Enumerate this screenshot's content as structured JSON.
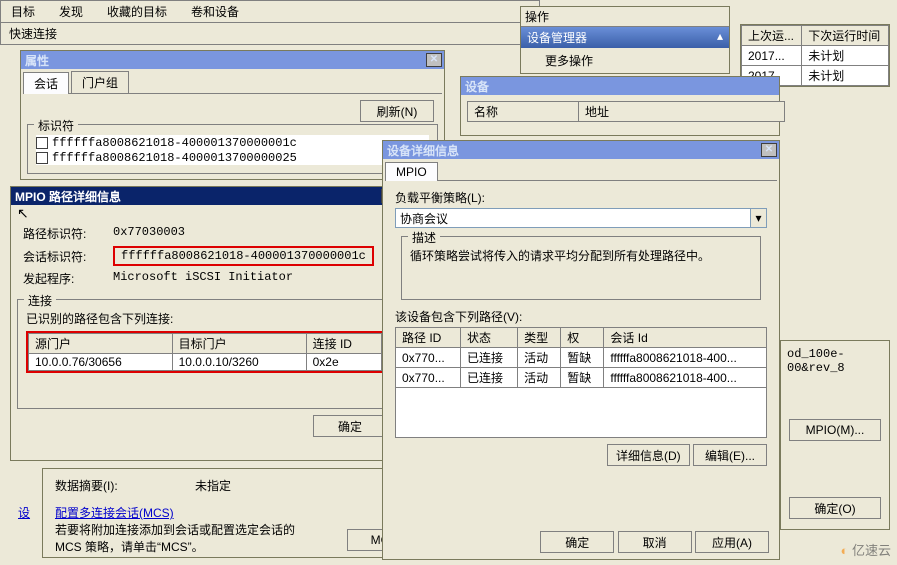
{
  "top_menu": [
    "目标",
    "发现",
    "收藏的目标",
    "卷和设备"
  ],
  "quick_connect": "快速连接",
  "last_run_cols": [
    "上次运...",
    "下次运行时间"
  ],
  "last_run_rows": [
    [
      "2017...",
      "未计划"
    ],
    [
      "2017",
      "未计划"
    ]
  ],
  "actions": {
    "title": "操作",
    "device_mgr": "设备管理器",
    "more": "更多操作"
  },
  "properties_win": {
    "title": "属性",
    "tabs": [
      "会话",
      "门户组"
    ],
    "refresh_btn": "刷新(N)",
    "ident_label": "标识符",
    "idents": [
      "ffffffa8008621018-400001370000001c",
      "ffffffa8008621018-4000013700000025"
    ]
  },
  "mpio_win": {
    "title": "MPIO 路径详细信息",
    "path_id_label": "路径标识符:",
    "path_id": "0x77030003",
    "session_id_label": "会话标识符:",
    "session_id": "ffffffa8008621018-400001370000001c",
    "initiator_label": "发起程序:",
    "initiator": "Microsoft iSCSI Initiator",
    "conn_group": "连接",
    "conn_desc": "已识别的路径包含下列连接:",
    "conn_cols": [
      "源门户",
      "目标门户",
      "连接 ID"
    ],
    "conn_row": [
      "10.0.0.76/30656",
      "10.0.0.10/3260",
      "0x2e"
    ],
    "ok_btn": "确定",
    "data_summary_lbl": "数据摘要(I):",
    "data_summary_val": "未指定",
    "mcs_title": "配置多连接会话(MCS)",
    "mcs_desc": "若要将附加连接添加到会话或配置选定会话的\nMCS 策略，请单击“MCS”。",
    "mcs_btn": "MCS"
  },
  "device_win": {
    "title": "设备",
    "cols": [
      "名称",
      "地址"
    ]
  },
  "detail_win": {
    "title": "设备详细信息",
    "tab": "MPIO",
    "lb_label": "负载平衡策略(L):",
    "lb_value": "协商会议",
    "desc_group": "描述",
    "desc_text": "循环策略尝试将传入的请求平均分配到所有处理路径中。",
    "paths_label": "该设备包含下列路径(V):",
    "path_cols": [
      "路径 ID",
      "状态",
      "类型",
      "权",
      "会话 Id"
    ],
    "path_rows": [
      [
        "0x770...",
        "已连接",
        "活动",
        "暂缺",
        "ffffffa8008621018-400..."
      ],
      [
        "0x770...",
        "已连接",
        "活动",
        "暂缺",
        "ffffffa8008621018-400..."
      ]
    ],
    "details_btn": "详细信息(D)",
    "edit_btn": "编辑(E)...",
    "ok_btn": "确定",
    "cancel_btn": "取消",
    "apply_btn": "应用(A)"
  },
  "right_panel": {
    "text": "od_100e-00&rev_8",
    "mpio_btn": "MPIO(M)...",
    "ok_btn": "确定(O)"
  },
  "watermark": "亿速云",
  "cursor": "↖"
}
